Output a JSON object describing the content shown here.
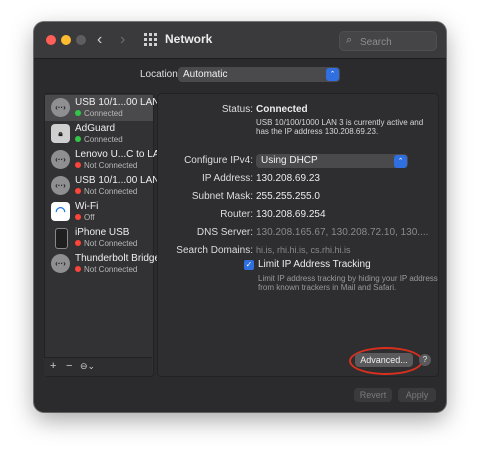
{
  "window": {
    "title": "Network",
    "search_placeholder": "Search",
    "back_icon": "‹",
    "forward_icon": "›"
  },
  "location": {
    "label": "Location:",
    "value": "Automatic"
  },
  "sidebar": {
    "items": [
      {
        "name": "USB 10/1...00 LAN 3",
        "status": "Connected",
        "status_color": "green",
        "icon": "ethernet-icon",
        "selected": true
      },
      {
        "name": "AdGuard",
        "status": "Connected",
        "status_color": "green",
        "icon": "lock-icon",
        "selected": false
      },
      {
        "name": "Lenovo U...C to LAN",
        "status": "Not Connected",
        "status_color": "red",
        "icon": "ethernet-icon",
        "selected": false
      },
      {
        "name": "USB 10/1...00 LAN 2",
        "status": "Not Connected",
        "status_color": "red",
        "icon": "ethernet-icon",
        "selected": false
      },
      {
        "name": "Wi-Fi",
        "status": "Off",
        "status_color": "red",
        "icon": "wifi-icon",
        "selected": false
      },
      {
        "name": "iPhone USB",
        "status": "Not Connected",
        "status_color": "red",
        "icon": "iphone-icon",
        "selected": false
      },
      {
        "name": "Thunderbolt Bridge",
        "status": "Not Connected",
        "status_color": "red",
        "icon": "ethernet-icon",
        "selected": false
      }
    ],
    "add": "+",
    "remove": "−",
    "action": "⊖⌄"
  },
  "detail": {
    "status_label": "Status:",
    "status_value": "Connected",
    "status_desc_1": "USB 10/100/1000 LAN 3 is currently active and",
    "status_desc_2": "has the IP address 130.208.69.23.",
    "configure_label": "Configure IPv4:",
    "configure_value": "Using DHCP",
    "ip_label": "IP Address:",
    "ip_value": "130.208.69.23",
    "subnet_label": "Subnet Mask:",
    "subnet_value": "255.255.255.0",
    "router_label": "Router:",
    "router_value": "130.208.69.254",
    "dns_label": "DNS Server:",
    "dns_value": "130.208.165.67, 130.208.72.10, 130....",
    "search_label": "Search Domains:",
    "search_value": "hi.is, rhi.hi.is, cs.rhi.hi.is",
    "limit_label": "Limit IP Address Tracking",
    "limit_checked": true,
    "limit_desc_1": "Limit IP address tracking by hiding your IP address",
    "limit_desc_2": "from known trackers in Mail and Safari.",
    "advanced_label": "Advanced...",
    "help_label": "?"
  },
  "footer": {
    "revert": "Revert",
    "apply": "Apply"
  },
  "colors": {
    "accent": "#2f6fe0",
    "connected": "#33c747",
    "not_connected": "#ff453a",
    "highlight_ring": "#d9301e"
  }
}
